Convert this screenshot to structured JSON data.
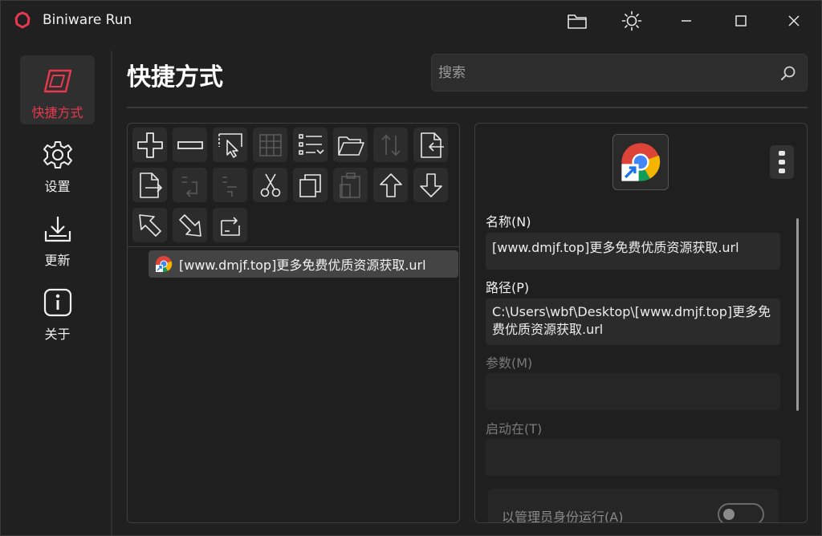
{
  "app": {
    "title": "Biniware Run",
    "accent": "#e8394f"
  },
  "nav": {
    "items": [
      {
        "label": "快捷方式",
        "icon": "shortcut-icon",
        "active": true
      },
      {
        "label": "设置",
        "icon": "gear-icon"
      },
      {
        "label": "更新",
        "icon": "download-icon"
      },
      {
        "label": "关于",
        "icon": "info-icon"
      }
    ]
  },
  "header": {
    "title": "快捷方式"
  },
  "search": {
    "placeholder": "搜索",
    "value": ""
  },
  "toolbar": {
    "buttons": [
      {
        "icon": "add-icon",
        "enabled": true
      },
      {
        "icon": "remove-icon",
        "enabled": true
      },
      {
        "icon": "select-pointer-icon",
        "enabled": true
      },
      {
        "icon": "grid-icon",
        "enabled": false
      },
      {
        "icon": "list-icon",
        "enabled": true
      },
      {
        "icon": "folder-open-icon",
        "enabled": true
      },
      {
        "icon": "sort-icon",
        "enabled": false
      },
      {
        "icon": "import-icon",
        "enabled": true
      },
      {
        "icon": "export-icon",
        "enabled": true
      },
      {
        "icon": "indent-icon",
        "enabled": false
      },
      {
        "icon": "outdent-icon",
        "enabled": false
      },
      {
        "icon": "cut-icon",
        "enabled": true
      },
      {
        "icon": "copy-icon",
        "enabled": true
      },
      {
        "icon": "paste-icon",
        "enabled": false
      },
      {
        "icon": "arrow-up-icon",
        "enabled": true
      },
      {
        "icon": "arrow-down-icon",
        "enabled": true
      },
      {
        "icon": "arrow-up-left-icon",
        "enabled": true
      },
      {
        "icon": "arrow-down-right-icon",
        "enabled": true
      },
      {
        "icon": "refresh-icon",
        "enabled": true
      }
    ]
  },
  "shortcuts": [
    {
      "label": "[www.dmjf.top]更多免费优质资源获取.url",
      "icon": "chrome-shortcut-icon"
    }
  ],
  "details": {
    "name_label": "名称(N)",
    "name_value": "[www.dmjf.top]更多免费优质资源获取.url",
    "path_label": "路径(P)",
    "path_value": "C:\\Users\\wbf\\Desktop\\[www.dmjf.top]更多免费优质资源获取.url",
    "args_label": "参数(M)",
    "args_value": "",
    "startin_label": "启动在(T)",
    "startin_value": "",
    "admin_label": "以管理员身份运行(A)",
    "admin_enabled": false
  }
}
